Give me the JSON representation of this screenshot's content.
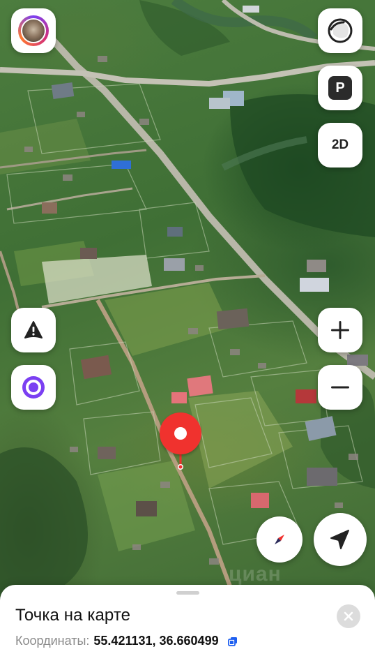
{
  "map": {
    "watermark": "циан",
    "nav_button_2d_label": "2D",
    "parking_label": "P"
  },
  "icons": {
    "avatar": "user-avatar",
    "layers": "layers-icon",
    "parking": "parking-icon",
    "alert": "road-alert-icon",
    "alice": "voice-assistant-icon",
    "zoom_in": "plus-icon",
    "zoom_out": "minus-icon",
    "compass": "compass-icon",
    "locate": "my-location-arrow-icon",
    "pin": "place-pin-icon",
    "close": "close-icon",
    "copy": "copy-icon"
  },
  "colors": {
    "pin_red": "#f0302d",
    "alice_purple": "#7b3ff2",
    "copy_blue": "#1e5ff0"
  },
  "sheet": {
    "title": "Точка на карте",
    "coords_label": "Координаты:",
    "coords_value": "55.421131, 36.660499"
  }
}
